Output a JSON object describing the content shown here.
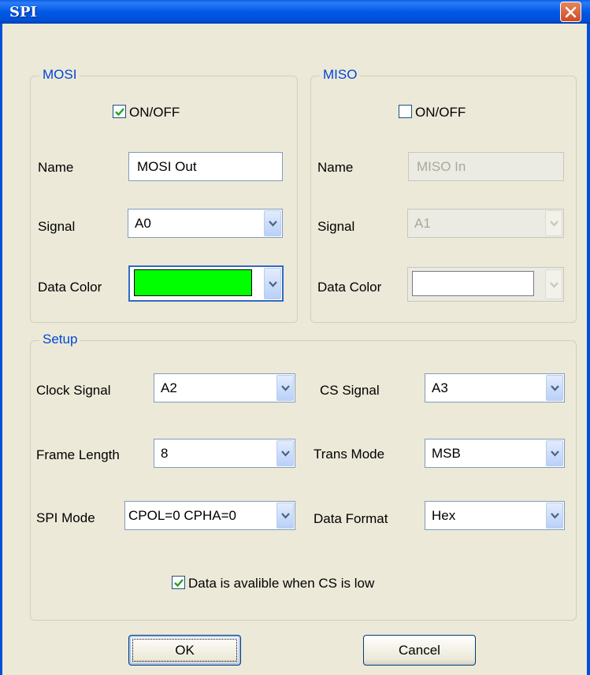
{
  "window": {
    "title": "SPI"
  },
  "mosi": {
    "legend": "MOSI",
    "on_off_label": "ON/OFF",
    "on_off_checked": true,
    "name_label": "Name",
    "name_value": "MOSI Out",
    "signal_label": "Signal",
    "signal_value": "A0",
    "data_color_label": "Data Color",
    "data_color": "#00ff00"
  },
  "miso": {
    "legend": "MISO",
    "on_off_label": "ON/OFF",
    "on_off_checked": false,
    "name_label": "Name",
    "name_value": "MISO In",
    "signal_label": "Signal",
    "signal_value": "A1",
    "data_color_label": "Data Color",
    "data_color": "#ffffff"
  },
  "setup": {
    "legend": "Setup",
    "clock_signal_label": "Clock Signal",
    "clock_signal_value": "A2",
    "cs_signal_label": "CS Signal",
    "cs_signal_value": "A3",
    "frame_length_label": "Frame Length",
    "frame_length_value": "8",
    "trans_mode_label": "Trans Mode",
    "trans_mode_value": "MSB",
    "spi_mode_label": "SPI Mode",
    "spi_mode_value": "CPOL=0 CPHA=0",
    "data_format_label": "Data Format",
    "data_format_value": "Hex",
    "cs_low_label": "Data is avalible when CS is low",
    "cs_low_checked": true
  },
  "buttons": {
    "ok": "OK",
    "cancel": "Cancel"
  },
  "colors": {
    "titlebar": "#0058e6",
    "legend": "#0046d5",
    "dialog_bg": "#ece9d8"
  }
}
